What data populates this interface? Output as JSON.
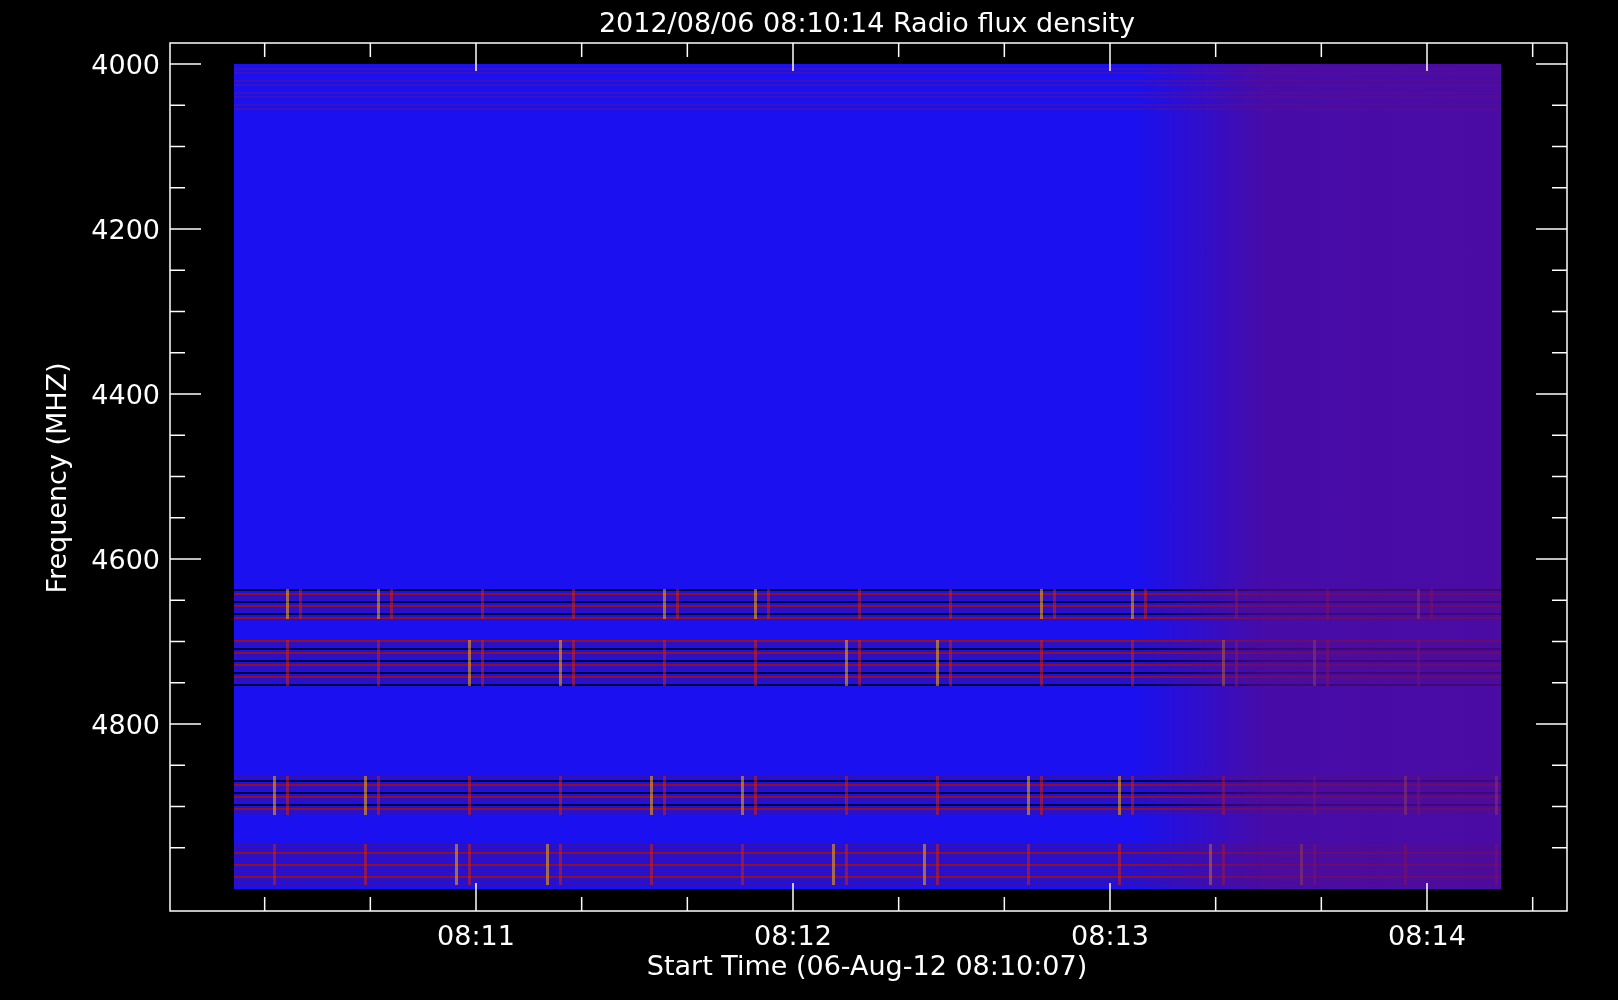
{
  "title": "2012/08/06 08:10:14 Radio flux density",
  "y_axis": {
    "label": "Frequency (MHZ)",
    "ticks": [
      "4000",
      "4200",
      "4400",
      "4600",
      "4800"
    ]
  },
  "x_axis": {
    "label": "Start Time (06-Aug-12 08:10:07)",
    "ticks": [
      "08:11",
      "08:12",
      "08:13",
      "08:14"
    ]
  }
}
